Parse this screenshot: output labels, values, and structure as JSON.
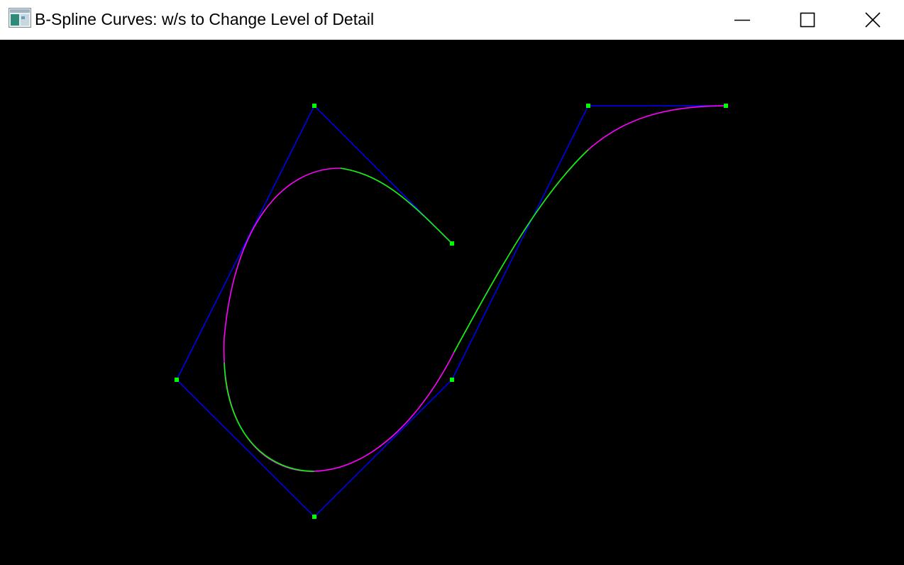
{
  "window": {
    "title": "B-Spline Curves: w/s to Change Level of Detail",
    "controls": [
      "minimize",
      "maximize",
      "close"
    ],
    "icons": {
      "app": "app-window-icon",
      "minimize": "minimize-icon",
      "maximize": "maximize-icon",
      "close": "close-icon"
    }
  },
  "scene": {
    "background_color": "#000000",
    "colors": {
      "control_polygon": "#0000ff",
      "control_point": "#00ff00",
      "curve_primary": "#00ff00",
      "curve_secondary": "#ff00ff"
    }
  }
}
